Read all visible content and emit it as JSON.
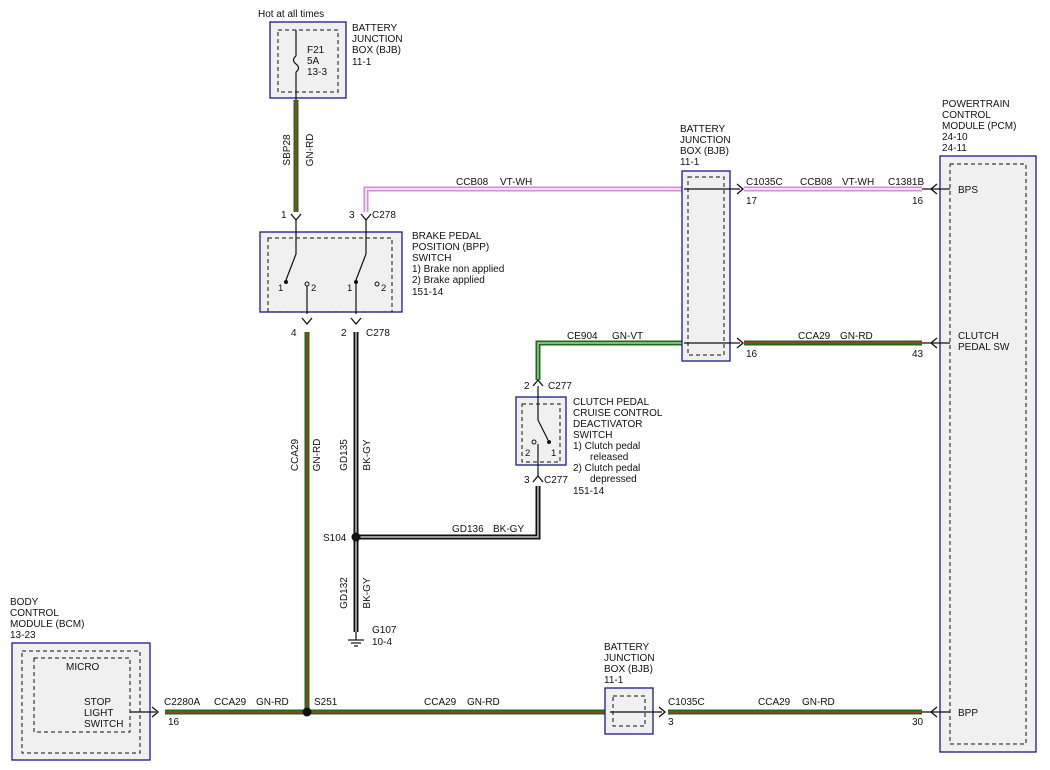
{
  "header": {
    "hot_label": "Hot at all times"
  },
  "bjb_top": {
    "name": [
      "BATTERY",
      "JUNCTION",
      "BOX (BJB)",
      "11-1"
    ],
    "fuse": [
      "F21",
      "5A",
      "13-3"
    ]
  },
  "bjb_mid": {
    "name": [
      "BATTERY",
      "JUNCTION",
      "BOX (BJB)",
      "11-1"
    ]
  },
  "bjb_bottom": {
    "name": [
      "BATTERY",
      "JUNCTION",
      "BOX (BJB)",
      "11-1"
    ]
  },
  "pcm": {
    "name": [
      "POWERTRAIN",
      "CONTROL",
      "MODULE (PCM)",
      "24-10",
      "24-11"
    ],
    "pins": {
      "bps": "BPS",
      "clutch_sw": [
        "CLUTCH",
        "PEDAL SW"
      ],
      "bpp": "BPP"
    }
  },
  "bpp_switch": {
    "name": [
      "BRAKE PEDAL",
      "POSITION (BPP)",
      "SWITCH"
    ],
    "notes": [
      "1) Brake non applied",
      "2) Brake applied",
      "151-14"
    ],
    "pin_labels": [
      "1",
      "2",
      "1",
      "2"
    ]
  },
  "clutch_switch": {
    "name": [
      "CLUTCH PEDAL",
      "CRUISE CONTROL",
      "DEACTIVATOR",
      "SWITCH"
    ],
    "notes": [
      "1) Clutch pedal",
      "released",
      "2) Clutch pedal",
      "depressed",
      "151-14"
    ],
    "pin_labels": [
      "2",
      "1"
    ]
  },
  "bcm": {
    "name": [
      "BODY",
      "CONTROL",
      "MODULE (BCM)",
      "13-23"
    ],
    "micro": "MICRO",
    "pin": [
      "STOP",
      "LIGHT",
      "SWITCH"
    ]
  },
  "connectors": {
    "c278_top": "C278",
    "c278_bottom": "C278",
    "c277_top": "C277",
    "c277_bottom": "C277",
    "c1035c_top": "C1035C",
    "c1381b": "C1381B",
    "c1035c_bottom": "C1035C",
    "c2280a": "C2280A"
  },
  "pins": {
    "bpp_in1": "1",
    "bpp_in3": "3",
    "bpp_out4": "4",
    "bpp_out2": "2",
    "clutch_in2": "2",
    "clutch_out3": "3",
    "bjb_17": "17",
    "bjb_16": "16",
    "pcm_16": "16",
    "pcm_43": "43",
    "bjb_bot_3": "3",
    "pcm_30": "30",
    "bcm_16": "16"
  },
  "splices": {
    "s104": "S104",
    "s251": "S251"
  },
  "ground": {
    "name": "G107",
    "ref": "10-4"
  },
  "wires": {
    "sbp28": {
      "circuit": "SBP28",
      "color": "GN-RD"
    },
    "ccb08_a": {
      "circuit": "CCB08",
      "color": "VT-WH"
    },
    "ccb08_b": {
      "circuit": "CCB08",
      "color": "VT-WH"
    },
    "ce904": {
      "circuit": "CE904",
      "color": "GN-VT"
    },
    "cca29_pcm": {
      "circuit": "CCA29",
      "color": "GN-RD"
    },
    "cca29_vert": {
      "circuit": "CCA29",
      "color": "GN-RD"
    },
    "gd135": {
      "circuit": "GD135",
      "color": "BK-GY"
    },
    "gd136": {
      "circuit": "GD136",
      "color": "BK-GY"
    },
    "gd132": {
      "circuit": "GD132",
      "color": "BK-GY"
    },
    "cca29_bcm": {
      "circuit": "CCA29",
      "color": "GN-RD"
    },
    "cca29_bot_a": {
      "circuit": "CCA29",
      "color": "GN-RD"
    },
    "cca29_bot_b": {
      "circuit": "CCA29",
      "color": "GN-RD"
    }
  },
  "colors": {
    "green": "#1f6a1f",
    "red_tracer": "#b43a1a",
    "violet": "#cf8fd6",
    "white_tracer": "#ffffff",
    "black": "#111111",
    "box_border": "#1a1a8c"
  }
}
